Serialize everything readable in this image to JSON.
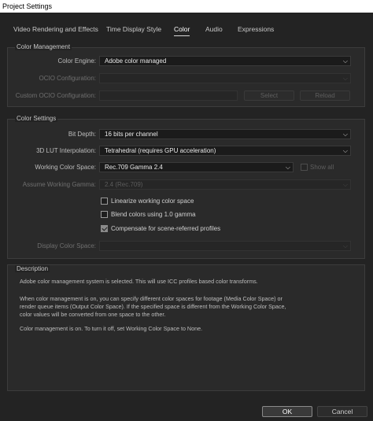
{
  "window": {
    "title": "Project Settings"
  },
  "tabs": [
    {
      "label": "Video Rendering and Effects"
    },
    {
      "label": "Time Display Style"
    },
    {
      "label": "Color"
    },
    {
      "label": "Audio"
    },
    {
      "label": "Expressions"
    }
  ],
  "color_management": {
    "title": "Color Management",
    "color_engine": {
      "label": "Color Engine:",
      "value": "Adobe color managed"
    },
    "ocio_configuration": {
      "label": "OCIO Configuration:",
      "value": ""
    },
    "custom_ocio": {
      "label": "Custom OCIO Configuration:",
      "value": "",
      "select_label": "Select",
      "reload_label": "Reload"
    }
  },
  "color_settings": {
    "title": "Color Settings",
    "bit_depth": {
      "label": "Bit Depth:",
      "value": "16 bits per channel"
    },
    "lut_interpolation": {
      "label": "3D LUT Interpolation:",
      "value": "Tetrahedral (requires GPU acceleration)"
    },
    "working_color_space": {
      "label": "Working Color Space:",
      "value": "Rec.709 Gamma 2.4",
      "show_all_label": "Show all"
    },
    "assume_working_gamma": {
      "label": "Assume Working Gamma:",
      "value": "2.4 (Rec.709)"
    },
    "linearize": {
      "label": "Linearize working color space",
      "checked": false
    },
    "blend_gamma": {
      "label": "Blend colors using 1.0 gamma",
      "checked": false
    },
    "compensate": {
      "label": "Compensate for scene-referred profiles",
      "checked": true
    },
    "display_color_space": {
      "label": "Display Color Space:",
      "value": ""
    }
  },
  "description": {
    "title": "Description",
    "line1": "Adobe color management system is selected. This will use ICC profiles based color transforms.",
    "line2": "When color management is on, you can specify different color spaces for footage (Media Color Space) or",
    "line3": "render queue items (Output Color Space). If the specified space is different from the Working Color Space,",
    "line4": "color values will be converted from one space to the other.",
    "line5": "Color management is on. To turn it off, set Working Color Space to None."
  },
  "footer": {
    "ok_label": "OK",
    "cancel_label": "Cancel"
  }
}
